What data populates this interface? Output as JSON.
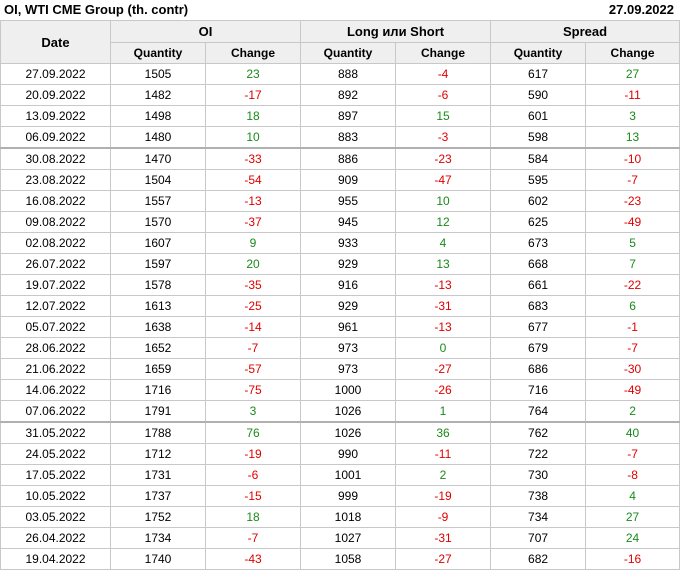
{
  "header": {
    "title": "OI, WTI CME Group (th. contr)",
    "date": "27.09.2022"
  },
  "table": {
    "date_label": "Date",
    "groups": [
      "OI",
      "Long или Short",
      "Spread"
    ],
    "subcolumns": [
      "Quantity",
      "Change"
    ],
    "rows": [
      {
        "date": "27.09.2022",
        "oi_q": "1505",
        "oi_c": "23",
        "ls_q": "888",
        "ls_c": "-4",
        "sp_q": "617",
        "sp_c": "27"
      },
      {
        "date": "20.09.2022",
        "oi_q": "1482",
        "oi_c": "-17",
        "ls_q": "892",
        "ls_c": "-6",
        "sp_q": "590",
        "sp_c": "-11"
      },
      {
        "date": "13.09.2022",
        "oi_q": "1498",
        "oi_c": "18",
        "ls_q": "897",
        "ls_c": "15",
        "sp_q": "601",
        "sp_c": "3"
      },
      {
        "date": "06.09.2022",
        "oi_q": "1480",
        "oi_c": "10",
        "ls_q": "883",
        "ls_c": "-3",
        "sp_q": "598",
        "sp_c": "13"
      },
      {
        "date": "30.08.2022",
        "oi_q": "1470",
        "oi_c": "-33",
        "ls_q": "886",
        "ls_c": "-23",
        "sp_q": "584",
        "sp_c": "-10"
      },
      {
        "date": "23.08.2022",
        "oi_q": "1504",
        "oi_c": "-54",
        "ls_q": "909",
        "ls_c": "-47",
        "sp_q": "595",
        "sp_c": "-7"
      },
      {
        "date": "16.08.2022",
        "oi_q": "1557",
        "oi_c": "-13",
        "ls_q": "955",
        "ls_c": "10",
        "sp_q": "602",
        "sp_c": "-23"
      },
      {
        "date": "09.08.2022",
        "oi_q": "1570",
        "oi_c": "-37",
        "ls_q": "945",
        "ls_c": "12",
        "sp_q": "625",
        "sp_c": "-49"
      },
      {
        "date": "02.08.2022",
        "oi_q": "1607",
        "oi_c": "9",
        "ls_q": "933",
        "ls_c": "4",
        "sp_q": "673",
        "sp_c": "5"
      },
      {
        "date": "26.07.2022",
        "oi_q": "1597",
        "oi_c": "20",
        "ls_q": "929",
        "ls_c": "13",
        "sp_q": "668",
        "sp_c": "7"
      },
      {
        "date": "19.07.2022",
        "oi_q": "1578",
        "oi_c": "-35",
        "ls_q": "916",
        "ls_c": "-13",
        "sp_q": "661",
        "sp_c": "-22"
      },
      {
        "date": "12.07.2022",
        "oi_q": "1613",
        "oi_c": "-25",
        "ls_q": "929",
        "ls_c": "-31",
        "sp_q": "683",
        "sp_c": "6"
      },
      {
        "date": "05.07.2022",
        "oi_q": "1638",
        "oi_c": "-14",
        "ls_q": "961",
        "ls_c": "-13",
        "sp_q": "677",
        "sp_c": "-1"
      },
      {
        "date": "28.06.2022",
        "oi_q": "1652",
        "oi_c": "-7",
        "ls_q": "973",
        "ls_c": "0",
        "sp_q": "679",
        "sp_c": "-7"
      },
      {
        "date": "21.06.2022",
        "oi_q": "1659",
        "oi_c": "-57",
        "ls_q": "973",
        "ls_c": "-27",
        "sp_q": "686",
        "sp_c": "-30"
      },
      {
        "date": "14.06.2022",
        "oi_q": "1716",
        "oi_c": "-75",
        "ls_q": "1000",
        "ls_c": "-26",
        "sp_q": "716",
        "sp_c": "-49"
      },
      {
        "date": "07.06.2022",
        "oi_q": "1791",
        "oi_c": "3",
        "ls_q": "1026",
        "ls_c": "1",
        "sp_q": "764",
        "sp_c": "2"
      },
      {
        "date": "31.05.2022",
        "oi_q": "1788",
        "oi_c": "76",
        "ls_q": "1026",
        "ls_c": "36",
        "sp_q": "762",
        "sp_c": "40"
      },
      {
        "date": "24.05.2022",
        "oi_q": "1712",
        "oi_c": "-19",
        "ls_q": "990",
        "ls_c": "-11",
        "sp_q": "722",
        "sp_c": "-7"
      },
      {
        "date": "17.05.2022",
        "oi_q": "1731",
        "oi_c": "-6",
        "ls_q": "1001",
        "ls_c": "2",
        "sp_q": "730",
        "sp_c": "-8"
      },
      {
        "date": "10.05.2022",
        "oi_q": "1737",
        "oi_c": "-15",
        "ls_q": "999",
        "ls_c": "-19",
        "sp_q": "738",
        "sp_c": "4"
      },
      {
        "date": "03.05.2022",
        "oi_q": "1752",
        "oi_c": "18",
        "ls_q": "1018",
        "ls_c": "-9",
        "sp_q": "734",
        "sp_c": "27"
      },
      {
        "date": "26.04.2022",
        "oi_q": "1734",
        "oi_c": "-7",
        "ls_q": "1027",
        "ls_c": "-31",
        "sp_q": "707",
        "sp_c": "24"
      },
      {
        "date": "19.04.2022",
        "oi_q": "1740",
        "oi_c": "-43",
        "ls_q": "1058",
        "ls_c": "-27",
        "sp_q": "682",
        "sp_c": "-16"
      }
    ]
  },
  "colors": {
    "positive": "#1a8a1a",
    "negative": "#e00000",
    "header_bg": "#efefef",
    "border": "#c8c8c8"
  }
}
